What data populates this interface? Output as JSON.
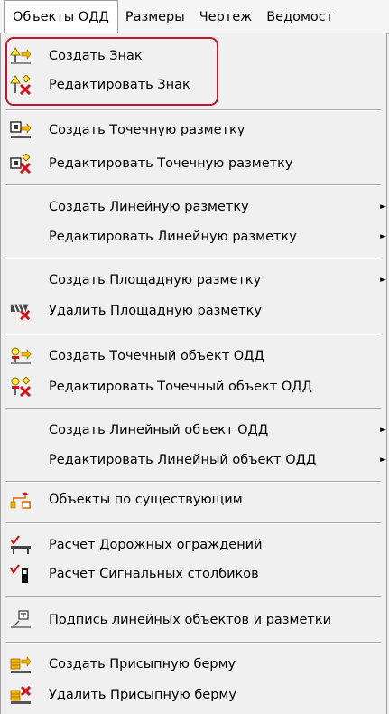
{
  "menubar": {
    "items": [
      "Объекты ОДД",
      "Размеры",
      "Чертеж",
      "Ведомост"
    ]
  },
  "menu": {
    "items": [
      {
        "label": "Создать Знак",
        "icon": "create-sign-icon"
      },
      {
        "label": "Редактировать Знак",
        "icon": "edit-sign-icon"
      },
      {
        "label": "Создать Точечную разметку",
        "icon": "create-point-marking-icon"
      },
      {
        "label": "Редактировать Точечную разметку",
        "icon": "edit-point-marking-icon"
      },
      {
        "label": "Создать Линейную разметку",
        "submenu": true
      },
      {
        "label": "Редактировать Линейную разметку",
        "submenu": true
      },
      {
        "label": "Создать Площадную разметку",
        "submenu": true
      },
      {
        "label": "Удалить Площадную разметку",
        "icon": "delete-area-marking-icon"
      },
      {
        "label": "Создать Точечный объект ОДД",
        "icon": "create-point-object-icon"
      },
      {
        "label": "Редактировать Точечный объект ОДД",
        "icon": "edit-point-object-icon"
      },
      {
        "label": "Создать Линейный объект ОДД",
        "submenu": true
      },
      {
        "label": "Редактировать Линейный объект ОДД",
        "submenu": true
      },
      {
        "label": "Объекты по существующим",
        "icon": "objects-existing-icon"
      },
      {
        "label": "Расчет Дорожных ограждений",
        "icon": "road-barriers-icon"
      },
      {
        "label": "Расчет Сигнальных столбиков",
        "icon": "signal-posts-icon"
      },
      {
        "label": "Подпись линейных объектов и разметки",
        "icon": "caption-icon"
      },
      {
        "label": "Создать Присыпную берму",
        "icon": "create-berm-icon"
      },
      {
        "label": "Удалить Присыпную берму",
        "icon": "delete-berm-icon"
      }
    ],
    "submenu_arrow": "►"
  },
  "colors": {
    "highlight": "#c0182b",
    "menu_bg": "#f0f0f0"
  }
}
